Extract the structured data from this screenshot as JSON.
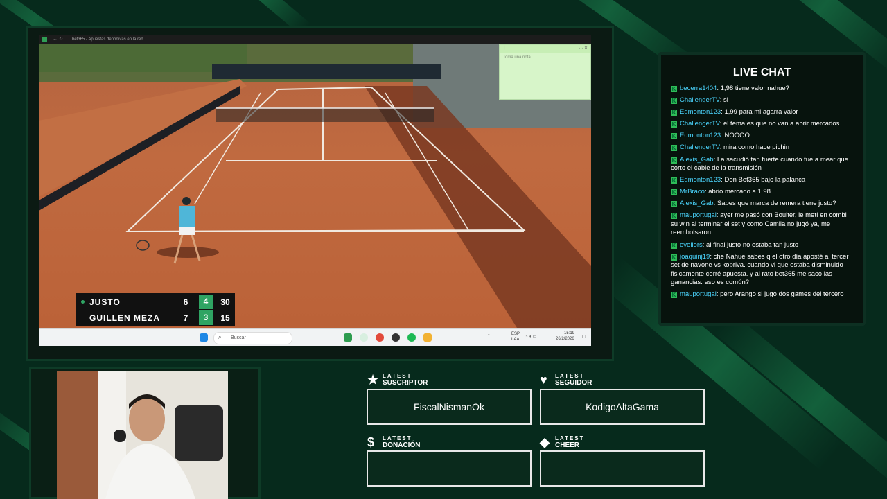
{
  "browser": {
    "nav": "←  ↻",
    "title": "bet365 - Apuestas deportivas en la red"
  },
  "note": {
    "pin": "|",
    "controls": "···  ✕",
    "placeholder": "Toma una nota..."
  },
  "scoreboard": {
    "players": [
      {
        "name": "JUSTO",
        "sets": "6",
        "games": "4",
        "points": "30",
        "serving": true
      },
      {
        "name": "GUILLEN MEZA",
        "sets": "7",
        "games": "3",
        "points": "15",
        "serving": false
      }
    ]
  },
  "taskbar": {
    "search_placeholder": "Buscar",
    "lang": "ESP",
    "lang2": "LAA",
    "time": "15:19",
    "date": "26/2/2026"
  },
  "chat": {
    "title": "LIVE CHAT",
    "messages": [
      {
        "user": "becerra1404",
        "text": "1,98 tiene valor nahue?"
      },
      {
        "user": "ChallengerTV",
        "text": "si"
      },
      {
        "user": "Edmonton123",
        "text": "1,99 para mi agarra valor"
      },
      {
        "user": "ChallengerTV",
        "text": "el tema es que no van a abrir mercados"
      },
      {
        "user": "Edmonton123",
        "text": "NOOOO"
      },
      {
        "user": "ChallengerTV",
        "text": "mira como hace pichin"
      },
      {
        "user": "Alexis_Gab",
        "text": "La sacudió tan fuerte cuando fue a mear que corto el cable de la transmisión"
      },
      {
        "user": "Edmonton123",
        "text": "Don Bet365 bajo la palanca"
      },
      {
        "user": "MrBraco",
        "text": "abrio mercado a 1.98"
      },
      {
        "user": "Alexis_Gab",
        "text": "Sabes que marca de remera tiene justo?"
      },
      {
        "user": "mauportugal",
        "text": "ayer me pasó con Boulter, le metí en combi su win al terminar el set y como Camila no jugó ya, me reembolsaron"
      },
      {
        "user": "eveliors",
        "text": "al final justo no estaba tan justo"
      },
      {
        "user": "joaquinj19",
        "text": "che Nahue sabes q el otro día aposté al tercer set de navone vs kopriva. cuando vi que estaba disminuido fisicamente cerré apuesta. y al rato bet365 me saco las ganancias. eso es común?"
      },
      {
        "user": "mauportugal",
        "text": "pero Arango si jugo dos games del tercero"
      }
    ]
  },
  "latest": {
    "suscriptor": {
      "label_top": "LATEST",
      "label_bottom": "SUSCRIPTOR",
      "value": "FiscalNismanOk"
    },
    "seguidor": {
      "label_top": "LATEST",
      "label_bottom": "SEGUIDOR",
      "value": "KodigoAltaGama"
    },
    "donacion": {
      "label_top": "LATEST",
      "label_bottom": "DONACIÓN",
      "value": ""
    },
    "cheer": {
      "label_top": "LATEST",
      "label_bottom": "CHEER",
      "value": ""
    }
  },
  "colors": {
    "accent_green": "#2fa463",
    "background": "#062a1c",
    "chat_user": "#4bd6ff"
  }
}
